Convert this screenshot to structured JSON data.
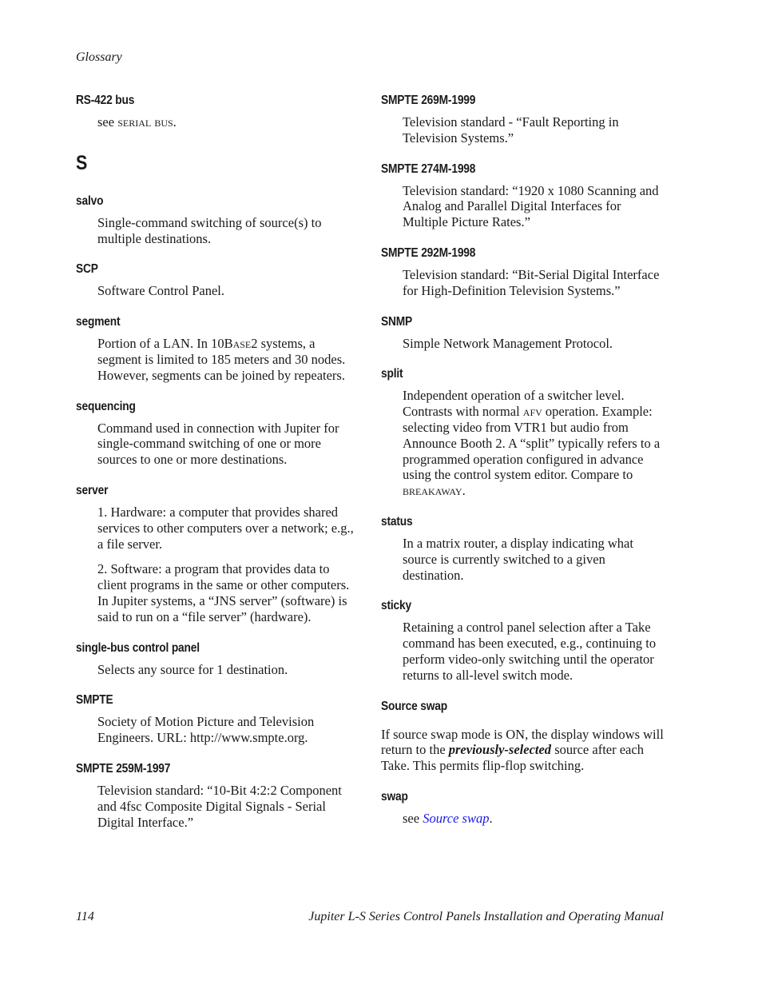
{
  "header": {
    "running_head": "Glossary"
  },
  "left_column": {
    "rs422": {
      "term": "RS-422 bus",
      "see": "see ",
      "ref": "serial bus",
      "end": "."
    },
    "section_letter": "S",
    "salvo": {
      "term": "salvo",
      "def": "Single-command switching of source(s) to multiple destinations."
    },
    "scp": {
      "term": "SCP",
      "def": "Software Control Panel."
    },
    "segment": {
      "term": "segment",
      "def_a": "Portion of a LAN. In 10B",
      "def_sc": "ase",
      "def_b": "2 systems, a segment is limited to 185 meters and 30 nodes. However, segments can be joined by repeaters."
    },
    "sequencing": {
      "term": "sequencing",
      "def": "Command used in connection with Jupiter for single-command switching of one or more sources to one or more destinations."
    },
    "server": {
      "term": "server",
      "def_1": "1. Hardware: a computer that provides shared services to other computers over a network; e.g., a file server.",
      "def_2": "2. Software: a program that provides data to client programs in the same or other computers. In Jupiter systems, a “JNS server” (software) is said to run on a “file server” (hardware)."
    },
    "single_bus": {
      "term": "single-bus control panel",
      "def": "Selects any source for 1 destination."
    },
    "smpte": {
      "term": "SMPTE",
      "def": "Society of Motion Picture and Television Engineers. URL: http://www.smpte.org."
    },
    "smpte259": {
      "term": "SMPTE 259M-1997",
      "def": "Television standard: “10-Bit 4:2:2 Component and 4fsc Composite Digital Signals - Serial Digital Interface.”"
    }
  },
  "right_column": {
    "smpte269": {
      "term": "SMPTE 269M-1999",
      "def": "Television standard - “Fault Reporting in Television Systems.”"
    },
    "smpte274": {
      "term": "SMPTE 274M-1998",
      "def": "Television standard: “1920 x 1080 Scanning and Analog and Parallel Digital Interfaces for Multiple Picture Rates.”"
    },
    "smpte292": {
      "term": "SMPTE 292M-1998",
      "def": "Television standard: “Bit-Serial Digital Interface for High-Definition Television Systems.”"
    },
    "snmp": {
      "term": "SNMP",
      "def": "Simple Network Management Protocol."
    },
    "split": {
      "term": "split",
      "def_a": "Independent operation of a switcher level. Contrasts with normal ",
      "def_sc1": "afv",
      "def_b": " operation. Example: selecting video from VTR1 but audio from Announce Booth 2. A “split” typically refers to a programmed operation configured in advance using the control system editor. Compare to ",
      "def_sc2": "breakaway",
      "def_c": "."
    },
    "status": {
      "term": "status",
      "def": "In a matrix router, a display indicating what source is currently switched to a given destination."
    },
    "sticky": {
      "term": "sticky",
      "def": "Retaining a control panel selection after a Take command has been executed, e.g., continuing to perform video-only switching until the operator returns to all-level switch mode."
    },
    "source_swap": {
      "term": "Source swap",
      "def_a": "If source swap mode is ON, the display windows will return to the ",
      "def_em": "previously-selected",
      "def_b": " source after each Take. This permits flip-flop switching."
    },
    "swap": {
      "term": "swap",
      "see": "see ",
      "link": "Source swap",
      "end": "."
    }
  },
  "footer": {
    "page_number": "114",
    "manual_title": "Jupiter L-S Series Control Panels Installation and Operating Manual"
  }
}
